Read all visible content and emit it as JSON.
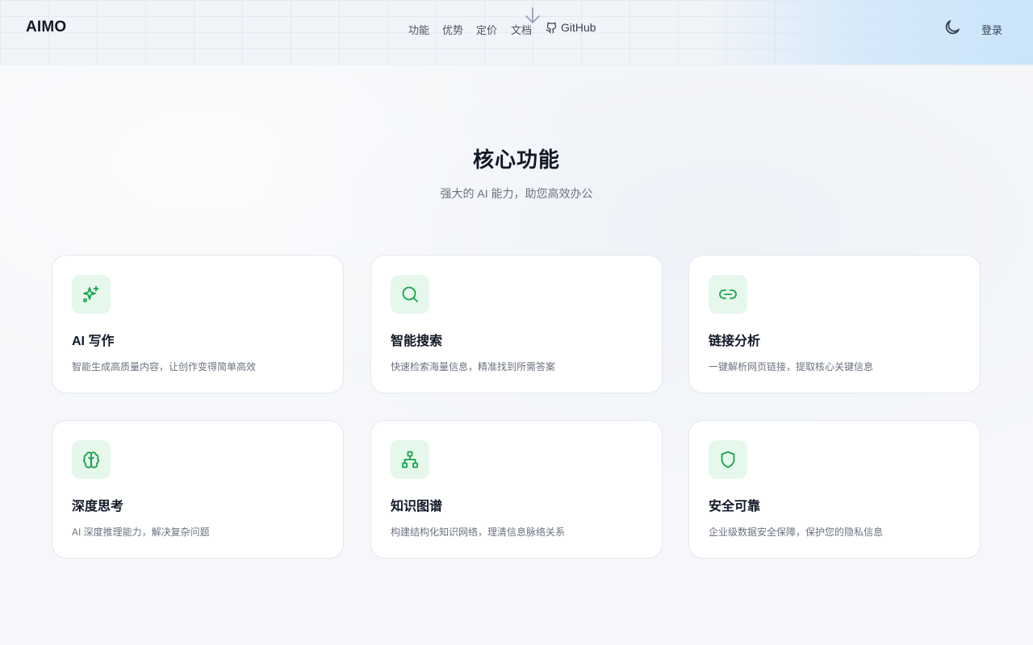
{
  "header": {
    "logo": "AIMO",
    "nav": [
      "功能",
      "优势",
      "定价",
      "文档"
    ],
    "github_label": "GitHub",
    "login_label": "登录",
    "icons": {
      "scroll": "arrow-down-icon",
      "github": "github-icon",
      "theme": "moon-icon"
    }
  },
  "features": {
    "title": "核心功能",
    "subtitle": "强大的 AI 能力，助您高效办公",
    "accent_color": "#16a34a",
    "icon_bg_color": "#e6f7ec",
    "cards": [
      {
        "icon": "sparkles-icon",
        "title": "AI 写作",
        "desc": "智能生成高质量内容，让创作变得简单高效"
      },
      {
        "icon": "search-icon",
        "title": "智能搜索",
        "desc": "快速检索海量信息，精准找到所需答案"
      },
      {
        "icon": "link-icon",
        "title": "链接分析",
        "desc": "一键解析网页链接，提取核心关键信息"
      },
      {
        "icon": "brain-icon",
        "title": "深度思考",
        "desc": "AI 深度推理能力，解决复杂问题"
      },
      {
        "icon": "network-icon",
        "title": "知识图谱",
        "desc": "构建结构化知识网络，理清信息脉络关系"
      },
      {
        "icon": "shield-icon",
        "title": "安全可靠",
        "desc": "企业级数据安全保障，保护您的隐私信息"
      }
    ]
  }
}
